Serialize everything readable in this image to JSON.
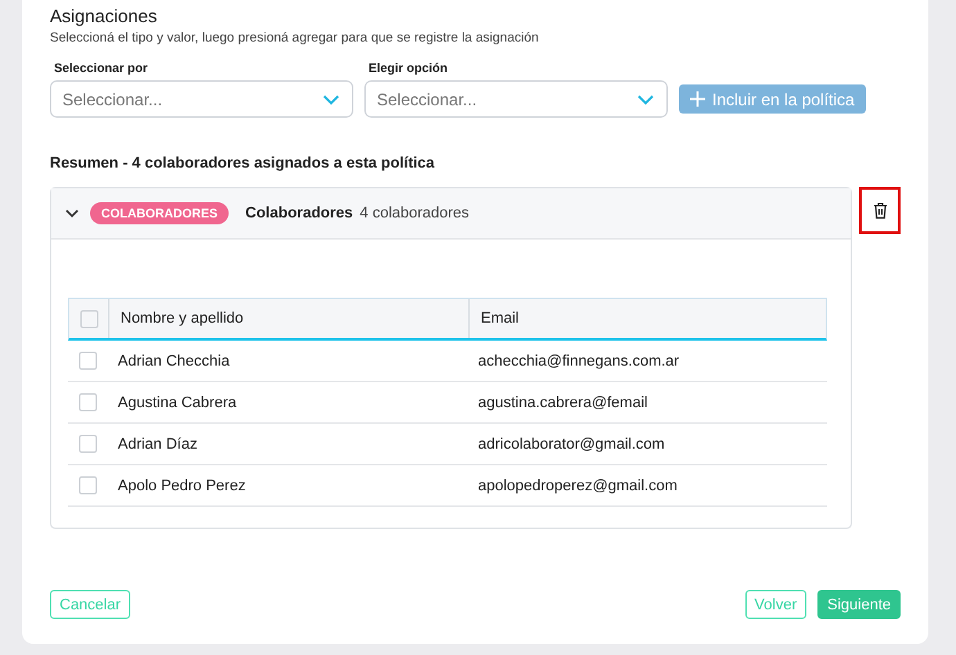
{
  "section": {
    "title": "Asignaciones",
    "subtitle": "Seleccioná el tipo y valor, luego presioná agregar para que se registre la asignación"
  },
  "selects": [
    {
      "label": "Seleccionar por",
      "placeholder": "Seleccionar..."
    },
    {
      "label": "Elegir opción",
      "placeholder": "Seleccionar..."
    }
  ],
  "add_button": {
    "label": "Incluir en la política",
    "disabled": true
  },
  "summary": "Resumen - 4 colaboradores asignados a esta política",
  "group": {
    "expanded": true,
    "badge": "COLABORADORES",
    "title": "Colaboradores",
    "count": "4 colaboradores",
    "delete_highlighted": true,
    "table": {
      "columns": [
        "Nombre y apellido",
        "Email"
      ],
      "header_checked": false,
      "rows": [
        {
          "name": "Adrian Checchia",
          "email": "achecchia@finnegans.com.ar",
          "checked": false
        },
        {
          "name": "Agustina Cabrera",
          "email": "agustina.cabrera@femail",
          "checked": false
        },
        {
          "name": "Adrian Díaz",
          "email": "adricolaborator@gmail.com",
          "checked": false
        },
        {
          "name": "Apolo Pedro Perez",
          "email": "apolopedroperez@gmail.com",
          "checked": false
        }
      ]
    }
  },
  "footer": {
    "cancel": "Cancelar",
    "back": "Volver",
    "next": "Siguiente"
  }
}
